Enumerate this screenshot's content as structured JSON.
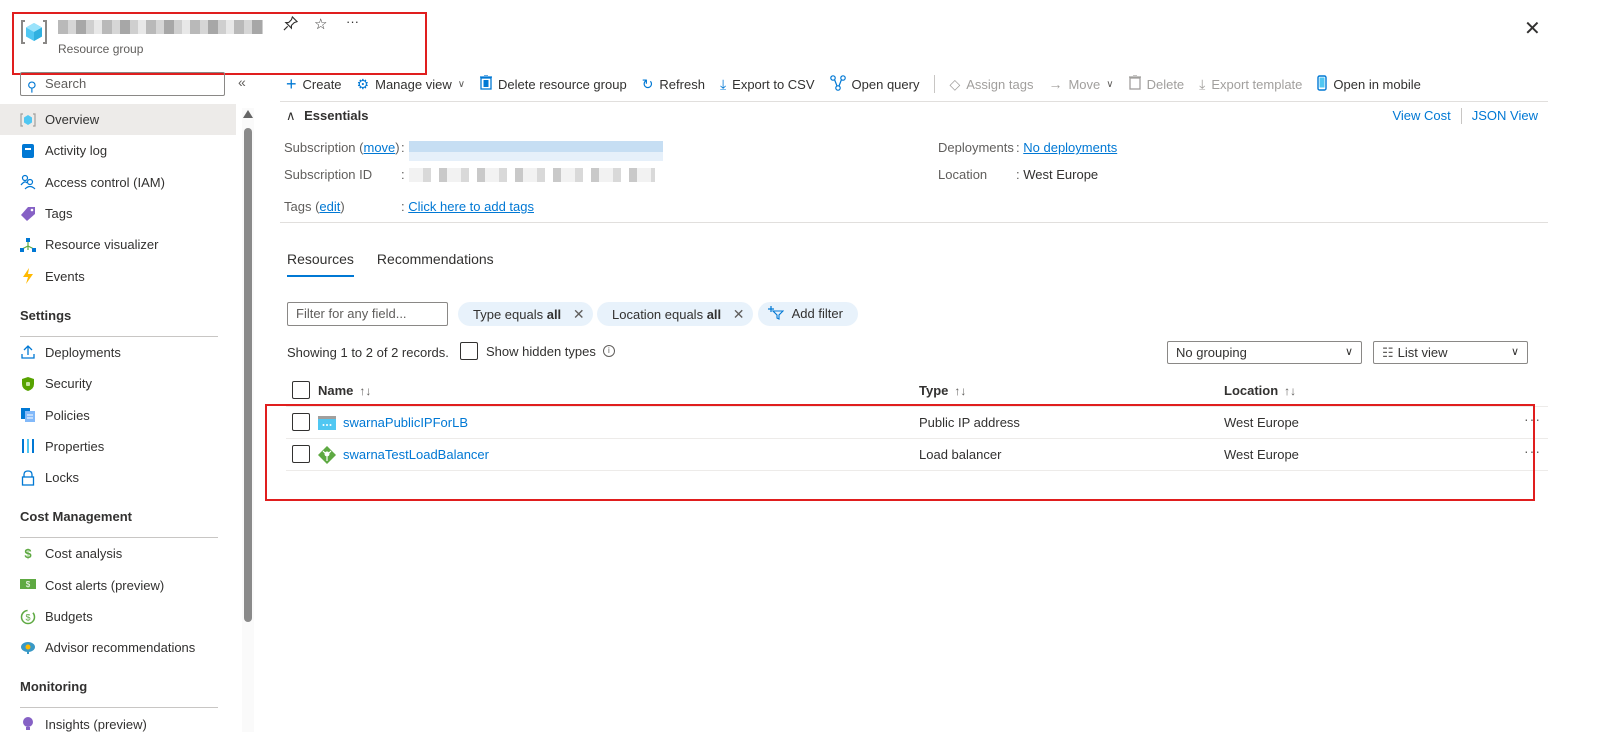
{
  "header": {
    "title_redacted": true,
    "subtitle": "Resource group",
    "pin_icon": "pin-icon",
    "favorite_icon": "star-icon",
    "more_label": "···",
    "close_label": "✕"
  },
  "sidebar": {
    "search_placeholder": "Search",
    "collapse_label": "«",
    "items": [
      {
        "label": "Overview",
        "icon": "resource-group-icon",
        "active": true
      },
      {
        "label": "Activity log",
        "icon": "activity-log-icon"
      },
      {
        "label": "Access control (IAM)",
        "icon": "iam-icon"
      },
      {
        "label": "Tags",
        "icon": "tag-icon"
      },
      {
        "label": "Resource visualizer",
        "icon": "visualizer-icon"
      },
      {
        "label": "Events",
        "icon": "lightning-icon"
      }
    ],
    "sections": [
      {
        "title": "Settings",
        "items": [
          {
            "label": "Deployments",
            "icon": "upload-icon"
          },
          {
            "label": "Security",
            "icon": "shield-icon"
          },
          {
            "label": "Policies",
            "icon": "policy-icon"
          },
          {
            "label": "Properties",
            "icon": "properties-icon"
          },
          {
            "label": "Locks",
            "icon": "lock-icon"
          }
        ]
      },
      {
        "title": "Cost Management",
        "items": [
          {
            "label": "Cost analysis",
            "icon": "cost-analysis-icon"
          },
          {
            "label": "Cost alerts (preview)",
            "icon": "cost-alert-icon"
          },
          {
            "label": "Budgets",
            "icon": "budget-icon"
          },
          {
            "label": "Advisor recommendations",
            "icon": "advisor-icon"
          }
        ]
      },
      {
        "title": "Monitoring",
        "items": [
          {
            "label": "Insights (preview)",
            "icon": "insights-icon"
          }
        ]
      }
    ]
  },
  "toolbar": {
    "create": "Create",
    "manage_view": "Manage view",
    "delete_rg": "Delete resource group",
    "refresh": "Refresh",
    "export_csv": "Export to CSV",
    "open_query": "Open query",
    "assign_tags": "Assign tags",
    "move": "Move",
    "delete": "Delete",
    "export_template": "Export template",
    "open_mobile": "Open in mobile"
  },
  "essentials": {
    "title": "Essentials",
    "view_cost": "View Cost",
    "json_view": "JSON View",
    "subscription_label": "Subscription (",
    "subscription_move": "move",
    "subscription_label_end": ")",
    "subscription_id_label": "Subscription ID",
    "tags_label": "Tags (",
    "tags_edit": "edit",
    "tags_label_end": ")",
    "tags_value": "Click here to add tags",
    "deployments_label": "Deployments",
    "deployments_value": "No deployments",
    "location_label": "Location",
    "location_value": "West Europe",
    "colon": ":"
  },
  "tabs": [
    {
      "label": "Resources",
      "active": true
    },
    {
      "label": "Recommendations",
      "active": false
    }
  ],
  "filters": {
    "placeholder": "Filter for any field...",
    "type_pill_prefix": "Type equals ",
    "type_pill_value": "all",
    "location_pill_prefix": "Location equals ",
    "location_pill_value": "all",
    "add_filter": "Add filter"
  },
  "records_text": "Showing 1 to 2 of 2 records.",
  "show_hidden_types": "Show hidden types",
  "grouping": "No grouping",
  "view_mode": "List view",
  "table": {
    "columns": [
      "Name",
      "Type",
      "Location"
    ],
    "sort_label": "↑↓",
    "rows": [
      {
        "name": "swarnaPublicIPForLB",
        "type": "Public IP address",
        "location": "West Europe",
        "icon": "public-ip-icon"
      },
      {
        "name": "swarnaTestLoadBalancer",
        "type": "Load balancer",
        "location": "West Europe",
        "icon": "load-balancer-icon"
      }
    ],
    "row_more": "···"
  }
}
